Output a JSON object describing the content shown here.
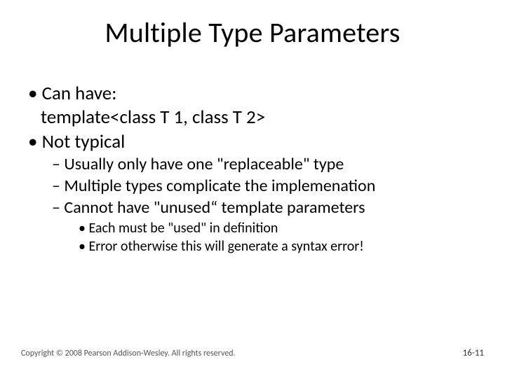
{
  "title": "Multiple Type Parameters",
  "bullets": {
    "b1": "Can have:",
    "b1_cont": "template<class T 1, class T 2>",
    "b2": "Not typical",
    "b2_1": "Usually only have one \"replaceable\" type",
    "b2_2": "Multiple types complicate the implemenation",
    "b2_3": "Cannot have \"unused“ template parameters",
    "b2_3_1": "Each must be \"used\" in definition",
    "b2_3_2": "Error otherwise this will generate a syntax error!"
  },
  "footer": {
    "copyright": "Copyright © 2008 Pearson Addison-Wesley. All rights reserved.",
    "page": "16-11"
  }
}
